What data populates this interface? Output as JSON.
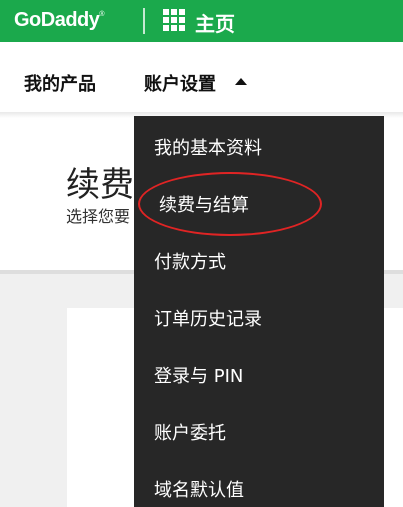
{
  "header": {
    "logo_text": "GoDaddy",
    "logo_mark": "®",
    "apps_icon": "grid-icon",
    "home_label": "主页",
    "bar_color": "#1BA94C"
  },
  "nav": {
    "products_label": "我的产品",
    "account_settings_label": "账户设置",
    "account_caret_icon": "caret-up-icon"
  },
  "page": {
    "title": "续费",
    "subtitle": "选择您要"
  },
  "dropdown": {
    "background": "#272727",
    "items": [
      {
        "label": "我的基本资料"
      },
      {
        "label": "续费与结算",
        "highlighted": true
      },
      {
        "label": "付款方式"
      },
      {
        "label": "订单历史记录"
      },
      {
        "label": "登录与 PIN"
      },
      {
        "label": "账户委托"
      },
      {
        "label": "域名默认值"
      }
    ]
  },
  "annotation": {
    "ring_color": "#e02424"
  }
}
